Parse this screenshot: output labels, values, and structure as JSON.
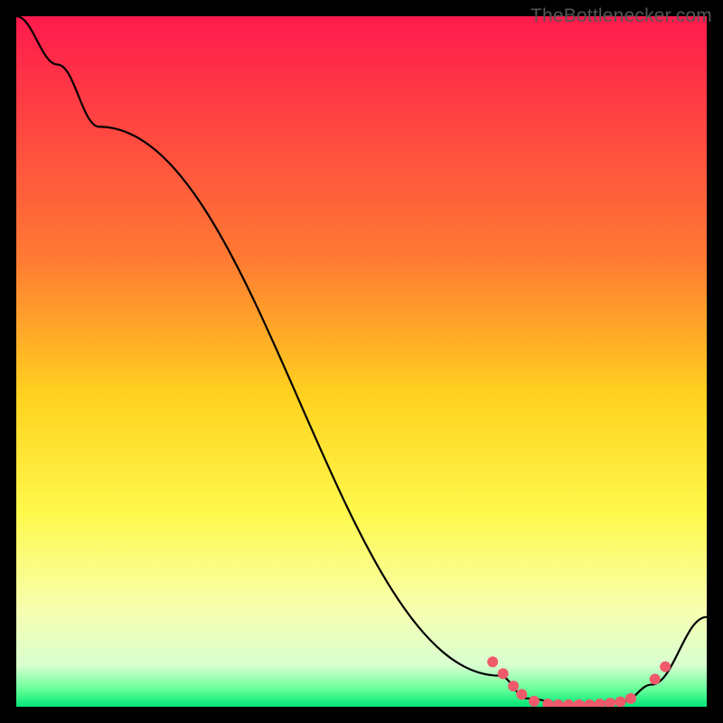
{
  "watermark": "TheBottlenecker.com",
  "chart_data": {
    "type": "line",
    "xlim": [
      0,
      100
    ],
    "ylim": [
      0,
      100
    ],
    "background": {
      "type": "vertical-gradient",
      "stops": [
        {
          "offset": 0.0,
          "color": "#ff1a4d"
        },
        {
          "offset": 0.35,
          "color": "#ff7a33"
        },
        {
          "offset": 0.55,
          "color": "#ffd21f"
        },
        {
          "offset": 0.72,
          "color": "#fff94d"
        },
        {
          "offset": 0.86,
          "color": "#f7ffb0"
        },
        {
          "offset": 0.94,
          "color": "#d9ffd0"
        },
        {
          "offset": 0.975,
          "color": "#66ff99"
        },
        {
          "offset": 1.0,
          "color": "#00e676"
        }
      ]
    },
    "series": [
      {
        "name": "bottleneck-curve",
        "color": "#000000",
        "points": [
          {
            "x": 0,
            "y": 100
          },
          {
            "x": 6,
            "y": 93
          },
          {
            "x": 12,
            "y": 84
          },
          {
            "x": 70,
            "y": 4.5
          },
          {
            "x": 74,
            "y": 1.2
          },
          {
            "x": 80,
            "y": 0.3
          },
          {
            "x": 88,
            "y": 0.8
          },
          {
            "x": 92,
            "y": 3.2
          },
          {
            "x": 100,
            "y": 13
          }
        ]
      }
    ],
    "markers": {
      "color": "#ef5a6b",
      "radius": 6,
      "points": [
        {
          "x": 69.0,
          "y": 6.5
        },
        {
          "x": 70.5,
          "y": 4.8
        },
        {
          "x": 72.0,
          "y": 3.0
        },
        {
          "x": 73.2,
          "y": 1.8
        },
        {
          "x": 75.0,
          "y": 0.8
        },
        {
          "x": 77.0,
          "y": 0.4
        },
        {
          "x": 78.5,
          "y": 0.3
        },
        {
          "x": 80.0,
          "y": 0.3
        },
        {
          "x": 81.5,
          "y": 0.3
        },
        {
          "x": 83.0,
          "y": 0.3
        },
        {
          "x": 84.5,
          "y": 0.4
        },
        {
          "x": 86.0,
          "y": 0.5
        },
        {
          "x": 87.5,
          "y": 0.7
        },
        {
          "x": 89.0,
          "y": 1.2
        },
        {
          "x": 92.5,
          "y": 4.0
        },
        {
          "x": 94.0,
          "y": 5.8
        }
      ]
    }
  }
}
